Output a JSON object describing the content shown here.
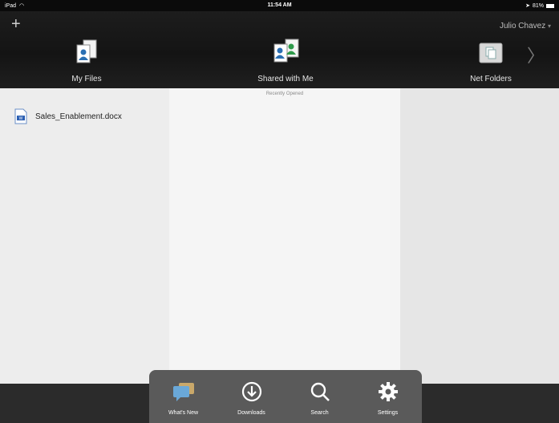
{
  "status_bar": {
    "device": "iPad",
    "time": "11:54 AM",
    "battery": "81%"
  },
  "header": {
    "user_name": "Julio Chavez",
    "nav": [
      {
        "label": "My Files",
        "icon": "my-files-icon"
      },
      {
        "label": "Shared with Me",
        "icon": "shared-with-me-icon"
      },
      {
        "label": "Net Folders",
        "icon": "net-folders-icon"
      }
    ]
  },
  "files": [
    {
      "name": "Sales_Enablement.docx",
      "icon": "word-doc-icon"
    }
  ],
  "recently_opened_label": "Recently Opened",
  "dock": [
    {
      "label": "What's New",
      "icon": "whats-new-icon"
    },
    {
      "label": "Downloads",
      "icon": "downloads-icon"
    },
    {
      "label": "Search",
      "icon": "search-icon"
    },
    {
      "label": "Settings",
      "icon": "settings-icon"
    }
  ]
}
